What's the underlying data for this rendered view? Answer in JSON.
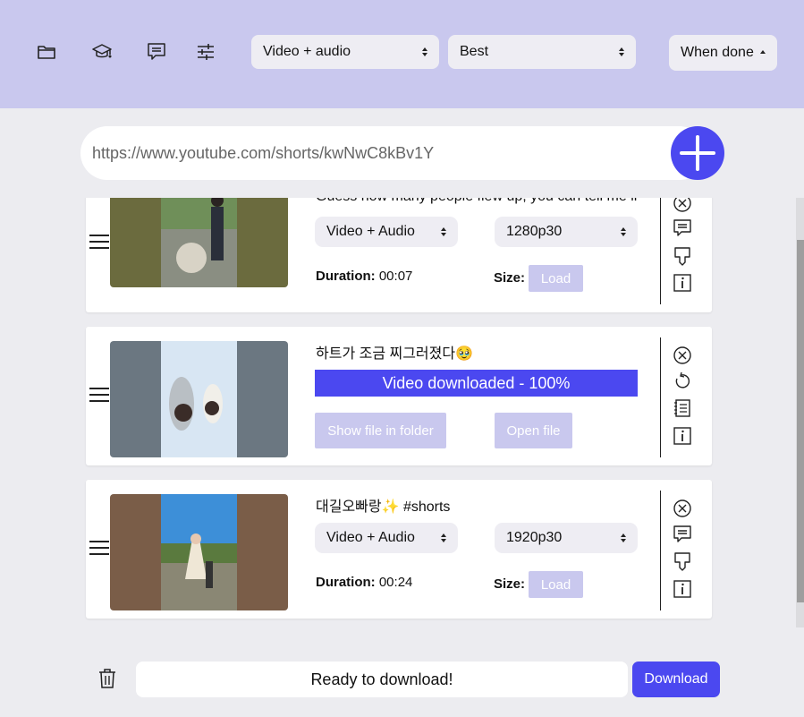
{
  "toolbar": {
    "icons": [
      "folder-icon",
      "graduation-cap-icon",
      "subtitles-icon",
      "settings-sliders-icon"
    ],
    "download_type": "Video + audio",
    "quality": "Best",
    "when_done": "When done"
  },
  "url_input": {
    "value": "https://www.youtube.com/shorts/kwNwC8kBv1Y"
  },
  "items": [
    {
      "title": "Guess how many people flew up, you can tell me in",
      "format": "Video + Audio",
      "resolution": "1280p30",
      "duration_label": "Duration:",
      "duration": "00:07",
      "size_label": "Size:",
      "load_label": "Load"
    },
    {
      "title": "하트가 조금 찌그러졌다🥹",
      "progress_text": "Video downloaded - 100%",
      "progress_percent": 100,
      "show_folder_label": "Show file in folder",
      "open_file_label": "Open file"
    },
    {
      "title": "대길오빠랑✨ #shorts",
      "format": "Video + Audio",
      "resolution": "1920p30",
      "duration_label": "Duration:",
      "duration": "00:24",
      "size_label": "Size:",
      "load_label": "Load"
    }
  ],
  "footer": {
    "status": "Ready to download!",
    "download_label": "Download"
  },
  "colors": {
    "accent": "#4b48f0",
    "topbar": "#c9c8ee",
    "soft": "#c9c8ee",
    "background": "#ececf0"
  }
}
